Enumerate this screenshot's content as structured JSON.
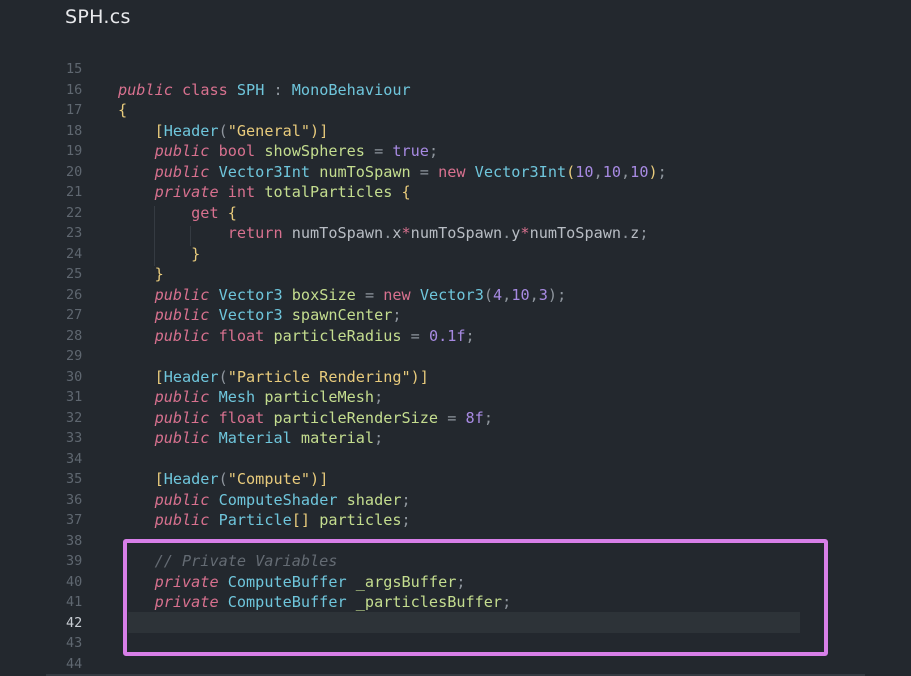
{
  "tab": {
    "title": "SPH.cs"
  },
  "editor": {
    "active_line": "42",
    "lines": [
      {
        "n": "15",
        "tokens": []
      },
      {
        "n": "16",
        "tokens": [
          {
            "t": "public",
            "c": "kw"
          },
          {
            "t": " ",
            "c": "pl"
          },
          {
            "t": "class",
            "c": "kw2"
          },
          {
            "t": " ",
            "c": "pl"
          },
          {
            "t": "SPH",
            "c": "ty"
          },
          {
            "t": " : ",
            "c": "pun"
          },
          {
            "t": "MonoBehaviour",
            "c": "ty"
          }
        ]
      },
      {
        "n": "17",
        "tokens": [
          {
            "t": "{",
            "c": "br"
          }
        ]
      },
      {
        "n": "18",
        "tokens": [
          {
            "t": "    [",
            "c": "br"
          },
          {
            "t": "Header",
            "c": "ty"
          },
          {
            "t": "(",
            "c": "pun"
          },
          {
            "t": "\"General\"",
            "c": "str"
          },
          {
            "t": ")]",
            "c": "br"
          }
        ]
      },
      {
        "n": "19",
        "tokens": [
          {
            "t": "    ",
            "c": "pl"
          },
          {
            "t": "public",
            "c": "kw"
          },
          {
            "t": " ",
            "c": "pl"
          },
          {
            "t": "bool",
            "c": "kw2"
          },
          {
            "t": " ",
            "c": "pl"
          },
          {
            "t": "showSpheres",
            "c": "id"
          },
          {
            "t": " = ",
            "c": "pun"
          },
          {
            "t": "true",
            "c": "num"
          },
          {
            "t": ";",
            "c": "pun"
          }
        ]
      },
      {
        "n": "20",
        "tokens": [
          {
            "t": "    ",
            "c": "pl"
          },
          {
            "t": "public",
            "c": "kw"
          },
          {
            "t": " ",
            "c": "pl"
          },
          {
            "t": "Vector3Int",
            "c": "ty"
          },
          {
            "t": " ",
            "c": "pl"
          },
          {
            "t": "numToSpawn",
            "c": "id"
          },
          {
            "t": " = ",
            "c": "pun"
          },
          {
            "t": "new",
            "c": "kw2"
          },
          {
            "t": " ",
            "c": "pl"
          },
          {
            "t": "Vector3Int",
            "c": "ty"
          },
          {
            "t": "(",
            "c": "br"
          },
          {
            "t": "10",
            "c": "num"
          },
          {
            "t": ",",
            "c": "pun"
          },
          {
            "t": "10",
            "c": "num"
          },
          {
            "t": ",",
            "c": "pun"
          },
          {
            "t": "10",
            "c": "num"
          },
          {
            "t": ")",
            "c": "br"
          },
          {
            "t": ";",
            "c": "pun"
          }
        ]
      },
      {
        "n": "21",
        "tokens": [
          {
            "t": "    ",
            "c": "pl"
          },
          {
            "t": "private",
            "c": "kw"
          },
          {
            "t": " ",
            "c": "pl"
          },
          {
            "t": "int",
            "c": "kw2"
          },
          {
            "t": " ",
            "c": "pl"
          },
          {
            "t": "totalParticles",
            "c": "id"
          },
          {
            "t": " ",
            "c": "pl"
          },
          {
            "t": "{",
            "c": "br"
          }
        ]
      },
      {
        "n": "22",
        "tokens": [
          {
            "t": "        ",
            "c": "pl"
          },
          {
            "t": "get",
            "c": "kw2"
          },
          {
            "t": " ",
            "c": "pl"
          },
          {
            "t": "{",
            "c": "br"
          }
        ]
      },
      {
        "n": "23",
        "tokens": [
          {
            "t": "            ",
            "c": "pl"
          },
          {
            "t": "return",
            "c": "kw2"
          },
          {
            "t": " numToSpawn",
            "c": "pl"
          },
          {
            "t": ".",
            "c": "pun"
          },
          {
            "t": "x",
            "c": "pl"
          },
          {
            "t": "*",
            "c": "kw2"
          },
          {
            "t": "numToSpawn",
            "c": "pl"
          },
          {
            "t": ".",
            "c": "pun"
          },
          {
            "t": "y",
            "c": "pl"
          },
          {
            "t": "*",
            "c": "kw2"
          },
          {
            "t": "numToSpawn",
            "c": "pl"
          },
          {
            "t": ".",
            "c": "pun"
          },
          {
            "t": "z",
            "c": "pl"
          },
          {
            "t": ";",
            "c": "pun"
          }
        ]
      },
      {
        "n": "24",
        "tokens": [
          {
            "t": "        ",
            "c": "pl"
          },
          {
            "t": "}",
            "c": "br"
          }
        ]
      },
      {
        "n": "25",
        "tokens": [
          {
            "t": "    ",
            "c": "pl"
          },
          {
            "t": "}",
            "c": "br"
          }
        ]
      },
      {
        "n": "26",
        "tokens": [
          {
            "t": "    ",
            "c": "pl"
          },
          {
            "t": "public",
            "c": "kw"
          },
          {
            "t": " ",
            "c": "pl"
          },
          {
            "t": "Vector3",
            "c": "ty"
          },
          {
            "t": " ",
            "c": "pl"
          },
          {
            "t": "boxSize",
            "c": "id"
          },
          {
            "t": " = ",
            "c": "pun"
          },
          {
            "t": "new",
            "c": "kw2"
          },
          {
            "t": " ",
            "c": "pl"
          },
          {
            "t": "Vector3",
            "c": "ty"
          },
          {
            "t": "(",
            "c": "pun"
          },
          {
            "t": "4",
            "c": "num"
          },
          {
            "t": ",",
            "c": "pun"
          },
          {
            "t": "10",
            "c": "num"
          },
          {
            "t": ",",
            "c": "pun"
          },
          {
            "t": "3",
            "c": "num"
          },
          {
            "t": ");",
            "c": "pun"
          }
        ]
      },
      {
        "n": "27",
        "tokens": [
          {
            "t": "    ",
            "c": "pl"
          },
          {
            "t": "public",
            "c": "kw"
          },
          {
            "t": " ",
            "c": "pl"
          },
          {
            "t": "Vector3",
            "c": "ty"
          },
          {
            "t": " ",
            "c": "pl"
          },
          {
            "t": "spawnCenter",
            "c": "id"
          },
          {
            "t": ";",
            "c": "pun"
          }
        ]
      },
      {
        "n": "28",
        "tokens": [
          {
            "t": "    ",
            "c": "pl"
          },
          {
            "t": "public",
            "c": "kw"
          },
          {
            "t": " ",
            "c": "pl"
          },
          {
            "t": "float",
            "c": "kw2"
          },
          {
            "t": " ",
            "c": "pl"
          },
          {
            "t": "particleRadius",
            "c": "id"
          },
          {
            "t": " = ",
            "c": "pun"
          },
          {
            "t": "0.1f",
            "c": "num"
          },
          {
            "t": ";",
            "c": "pun"
          }
        ]
      },
      {
        "n": "29",
        "tokens": []
      },
      {
        "n": "30",
        "tokens": [
          {
            "t": "    [",
            "c": "br"
          },
          {
            "t": "Header",
            "c": "ty"
          },
          {
            "t": "(",
            "c": "pun"
          },
          {
            "t": "\"Particle Rendering\"",
            "c": "str"
          },
          {
            "t": ")]",
            "c": "br"
          }
        ]
      },
      {
        "n": "31",
        "tokens": [
          {
            "t": "    ",
            "c": "pl"
          },
          {
            "t": "public",
            "c": "kw"
          },
          {
            "t": " ",
            "c": "pl"
          },
          {
            "t": "Mesh",
            "c": "ty"
          },
          {
            "t": " ",
            "c": "pl"
          },
          {
            "t": "particleMesh",
            "c": "id"
          },
          {
            "t": ";",
            "c": "pun"
          }
        ]
      },
      {
        "n": "32",
        "tokens": [
          {
            "t": "    ",
            "c": "pl"
          },
          {
            "t": "public",
            "c": "kw"
          },
          {
            "t": " ",
            "c": "pl"
          },
          {
            "t": "float",
            "c": "kw2"
          },
          {
            "t": " ",
            "c": "pl"
          },
          {
            "t": "particleRenderSize",
            "c": "id"
          },
          {
            "t": " = ",
            "c": "pun"
          },
          {
            "t": "8f",
            "c": "num"
          },
          {
            "t": ";",
            "c": "pun"
          }
        ]
      },
      {
        "n": "33",
        "tokens": [
          {
            "t": "    ",
            "c": "pl"
          },
          {
            "t": "public",
            "c": "kw"
          },
          {
            "t": " ",
            "c": "pl"
          },
          {
            "t": "Material",
            "c": "ty"
          },
          {
            "t": " ",
            "c": "pl"
          },
          {
            "t": "material",
            "c": "id"
          },
          {
            "t": ";",
            "c": "pun"
          }
        ]
      },
      {
        "n": "34",
        "tokens": []
      },
      {
        "n": "35",
        "tokens": [
          {
            "t": "    [",
            "c": "br"
          },
          {
            "t": "Header",
            "c": "ty"
          },
          {
            "t": "(",
            "c": "pun"
          },
          {
            "t": "\"Compute\"",
            "c": "str"
          },
          {
            "t": ")]",
            "c": "br"
          }
        ]
      },
      {
        "n": "36",
        "tokens": [
          {
            "t": "    ",
            "c": "pl"
          },
          {
            "t": "public",
            "c": "kw"
          },
          {
            "t": " ",
            "c": "pl"
          },
          {
            "t": "ComputeShader",
            "c": "ty"
          },
          {
            "t": " ",
            "c": "pl"
          },
          {
            "t": "shader",
            "c": "id"
          },
          {
            "t": ";",
            "c": "pun"
          }
        ]
      },
      {
        "n": "37",
        "tokens": [
          {
            "t": "    ",
            "c": "pl"
          },
          {
            "t": "public",
            "c": "kw"
          },
          {
            "t": " ",
            "c": "pl"
          },
          {
            "t": "Particle",
            "c": "ty"
          },
          {
            "t": "[]",
            "c": "br"
          },
          {
            "t": " ",
            "c": "pl"
          },
          {
            "t": "particles",
            "c": "id"
          },
          {
            "t": ";",
            "c": "pun"
          }
        ]
      },
      {
        "n": "38",
        "tokens": []
      },
      {
        "n": "39",
        "tokens": [
          {
            "t": "    ",
            "c": "pl"
          },
          {
            "t": "// Private Variables",
            "c": "cm"
          }
        ]
      },
      {
        "n": "40",
        "tokens": [
          {
            "t": "    ",
            "c": "pl"
          },
          {
            "t": "private",
            "c": "kw"
          },
          {
            "t": " ",
            "c": "pl"
          },
          {
            "t": "ComputeBuffer",
            "c": "ty"
          },
          {
            "t": " ",
            "c": "pl"
          },
          {
            "t": "_argsBuffer",
            "c": "id"
          },
          {
            "t": ";",
            "c": "pun"
          }
        ]
      },
      {
        "n": "41",
        "tokens": [
          {
            "t": "    ",
            "c": "pl"
          },
          {
            "t": "private",
            "c": "kw"
          },
          {
            "t": " ",
            "c": "pl"
          },
          {
            "t": "ComputeBuffer",
            "c": "ty"
          },
          {
            "t": " ",
            "c": "pl"
          },
          {
            "t": "_particlesBuffer",
            "c": "id"
          },
          {
            "t": ";",
            "c": "pun"
          }
        ]
      },
      {
        "n": "42",
        "tokens": []
      },
      {
        "n": "43",
        "tokens": []
      },
      {
        "n": "44",
        "tokens": []
      }
    ]
  },
  "colors": {
    "background": "#23282e",
    "highlight_box": "#d77fe8",
    "keyword": "#d8718f",
    "type": "#6fc6dc",
    "identifier": "#c4dd8f",
    "number": "#a78ae2",
    "string": "#e8cb7c",
    "comment": "#646b73"
  }
}
